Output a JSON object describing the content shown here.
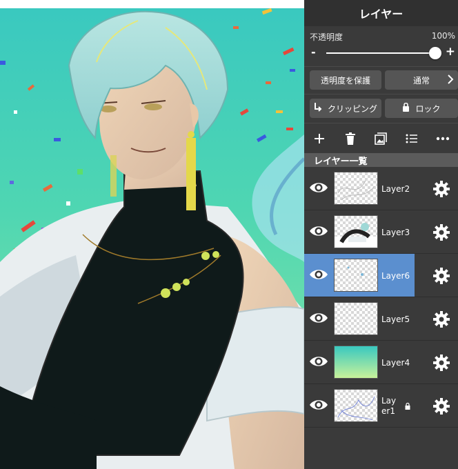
{
  "panel": {
    "title": "レイヤー",
    "opacity": {
      "label": "不透明度",
      "value_text": "100%",
      "minus": "-",
      "plus": "+",
      "level": 1.0
    },
    "protect_alpha_label": "透明度を保護",
    "blend_mode_label": "通常",
    "clipping_label": "クリッピング",
    "lock_label": "ロック",
    "toolbar": [
      "add-icon",
      "trash-icon",
      "image-icon",
      "list-icon",
      "more-icon"
    ],
    "list_header": "レイヤー一覧",
    "layers": [
      {
        "name": "Layer2",
        "visible": true,
        "selected": false,
        "locked": false,
        "thumb": "sketch"
      },
      {
        "name": "Layer3",
        "visible": true,
        "selected": false,
        "locked": false,
        "thumb": "figure"
      },
      {
        "name": "Layer6",
        "visible": true,
        "selected": true,
        "locked": false,
        "thumb": "sparse"
      },
      {
        "name": "Layer5",
        "visible": true,
        "selected": false,
        "locked": false,
        "thumb": "empty"
      },
      {
        "name": "Layer4",
        "visible": true,
        "selected": false,
        "locked": false,
        "thumb": "gradient"
      },
      {
        "name": "Layer1",
        "visible": true,
        "selected": false,
        "locked": true,
        "thumb": "blue-sketch"
      }
    ],
    "colors": {
      "panel_bg": "#3a3a3a",
      "selected": "#5b8fcf",
      "button": "#555555"
    }
  },
  "layer1_label_lines": [
    "Lay",
    "er1"
  ]
}
